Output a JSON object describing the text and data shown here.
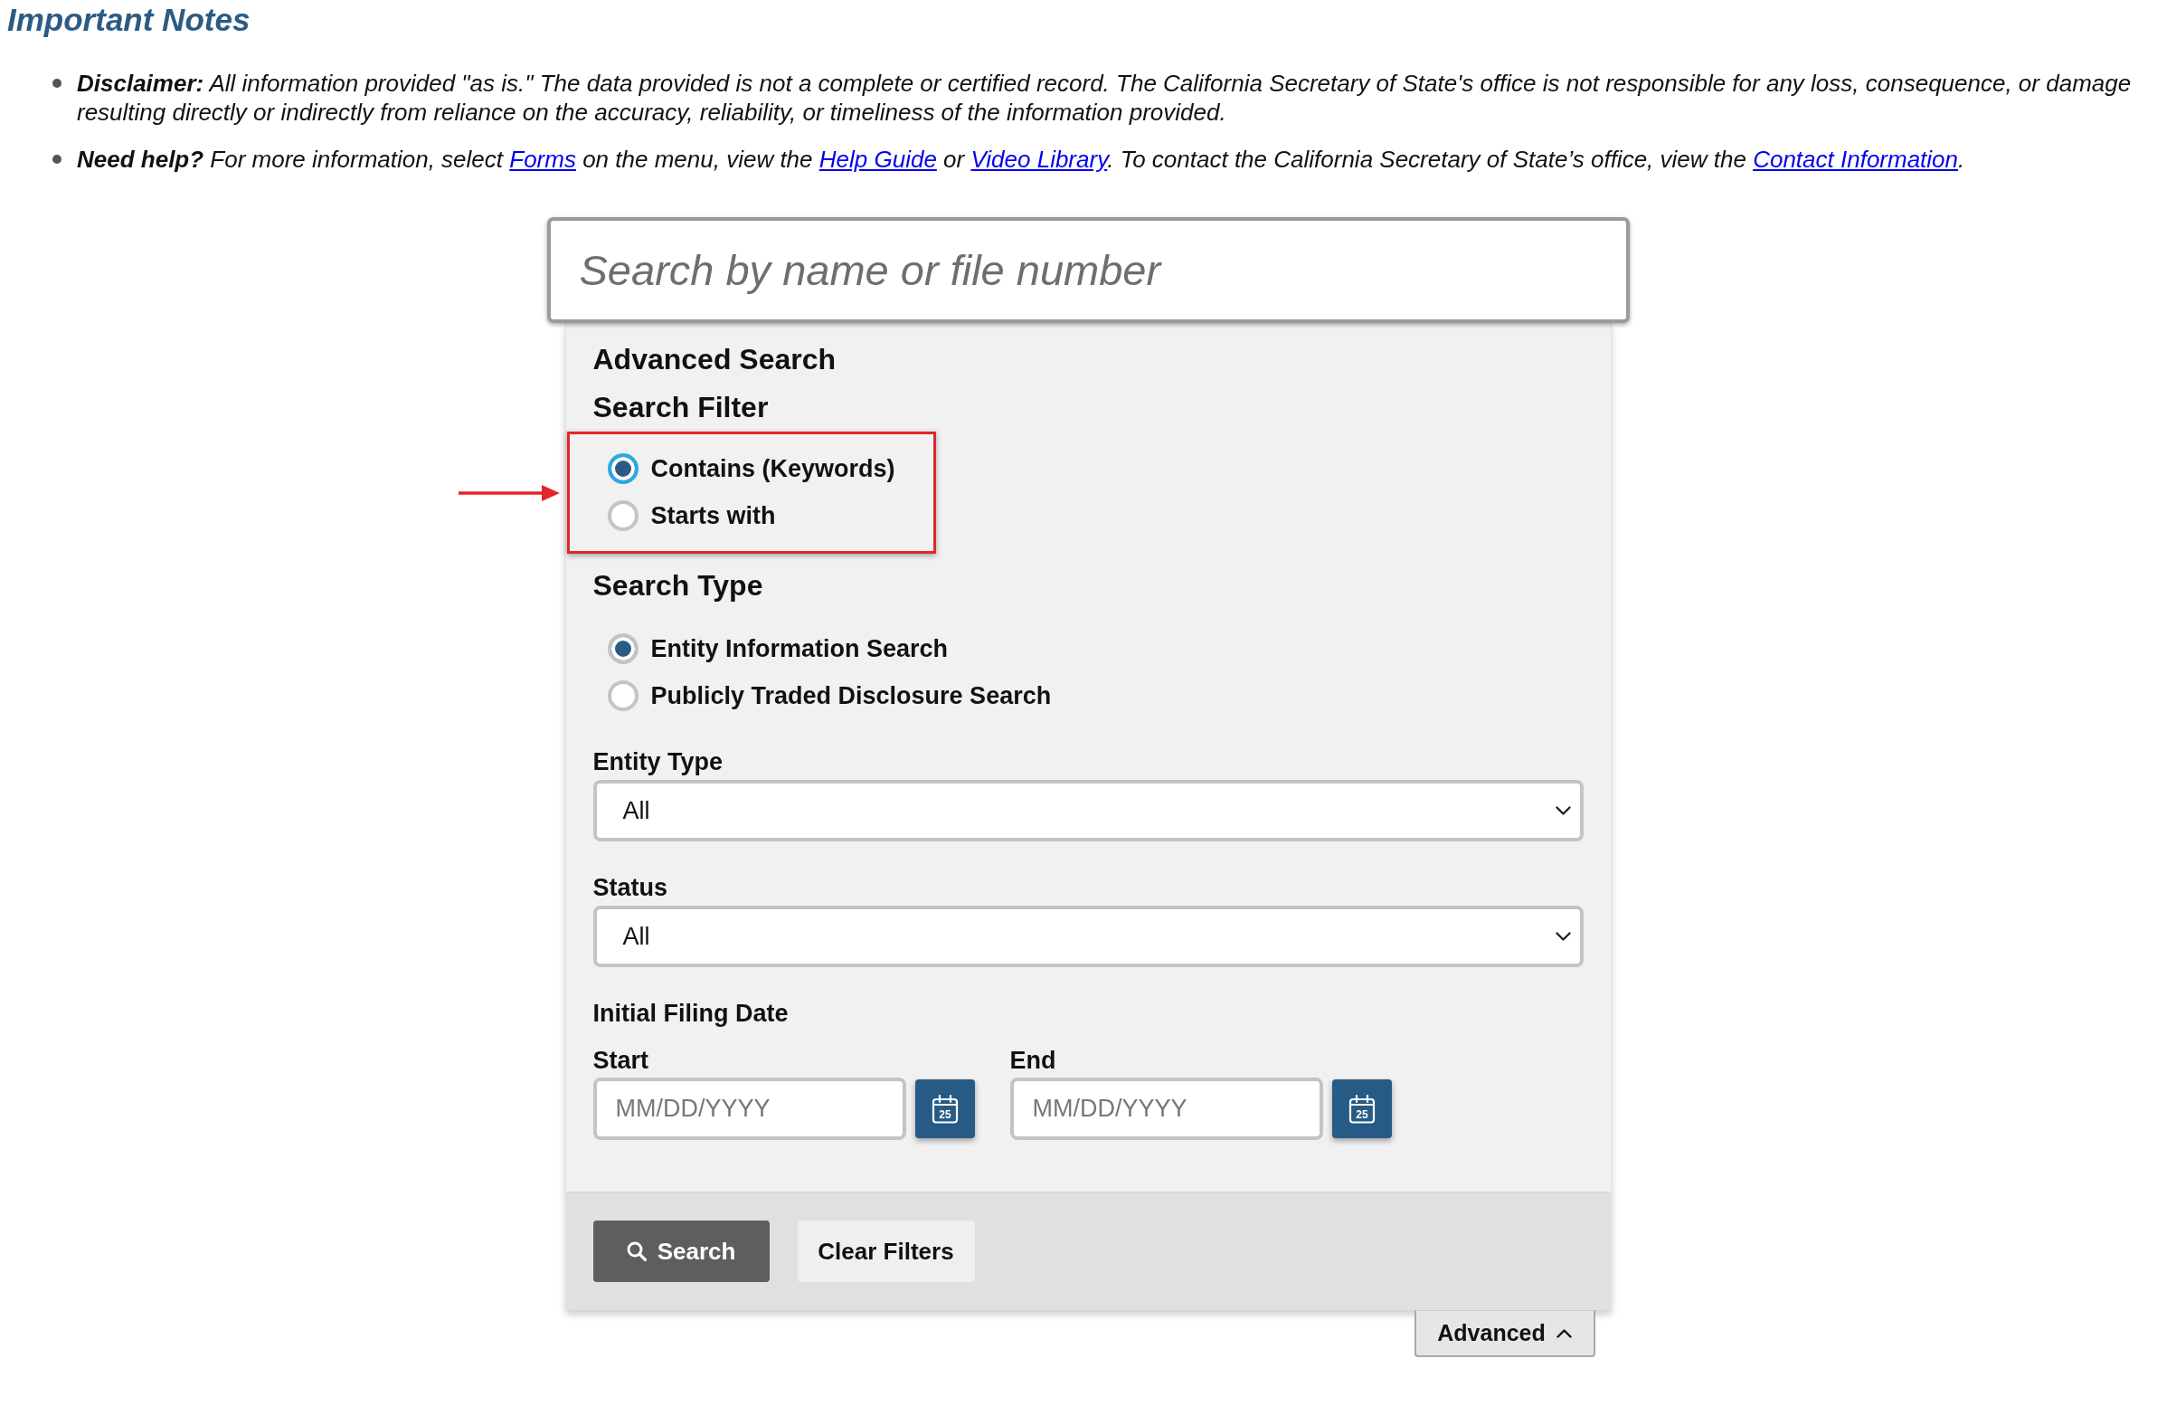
{
  "notes": {
    "title": "Important Notes",
    "items": [
      {
        "segments": [
          {
            "kind": "text",
            "text": "**Disclaimer:** All information provided \"as is.\" The data provided is not a complete or certified record. The California Secretary of State's office is not responsible for any loss, consequence, or damage resulting directly or indirectly from reliance on the accuracy, reliability, or timeliness of the information provided."
          }
        ]
      },
      {
        "segments": [
          {
            "kind": "text",
            "text": "**Need help?** For more information, select "
          },
          {
            "kind": "link",
            "text": "Forms"
          },
          {
            "kind": "text",
            "text": " on the menu, view the "
          },
          {
            "kind": "link",
            "text": "Help Guide"
          },
          {
            "kind": "text",
            "text": " or "
          },
          {
            "kind": "link",
            "text": "Video Library"
          },
          {
            "kind": "text",
            "text": ". To contact the California Secretary of State’s office, view the "
          },
          {
            "kind": "link",
            "text": "Contact Information"
          },
          {
            "kind": "text",
            "text": "."
          }
        ]
      }
    ]
  },
  "search": {
    "placeholder": "Search by name or file number"
  },
  "advanced_search": {
    "title": "Advanced Search",
    "search_filter": {
      "title": "Search Filter",
      "highlighted": true,
      "options": [
        {
          "label": "Contains (Keywords)",
          "selected": true,
          "focused": true
        },
        {
          "label": "Starts with",
          "selected": false,
          "focused": false
        }
      ]
    },
    "search_type": {
      "title": "Search Type",
      "options": [
        {
          "label": "Entity Information Search",
          "selected": true,
          "focused": false
        },
        {
          "label": "Publicly Traded Disclosure Search",
          "selected": false,
          "focused": false
        }
      ]
    },
    "selects": [
      {
        "label": "Entity Type",
        "value": "All"
      },
      {
        "label": "Status",
        "value": "All"
      }
    ],
    "filing_date": {
      "title": "Initial Filing Date",
      "fields": [
        {
          "label": "Start",
          "placeholder": "MM/DD/YYYY",
          "calendar_day": "25"
        },
        {
          "label": "End",
          "placeholder": "MM/DD/YYYY",
          "calendar_day": "25"
        }
      ]
    },
    "buttons": [
      {
        "kind": "primary",
        "label": "Search"
      },
      {
        "kind": "secondary",
        "label": "Clear Filters"
      }
    ],
    "toggle": {
      "label": "Advanced",
      "expanded": true
    }
  }
}
